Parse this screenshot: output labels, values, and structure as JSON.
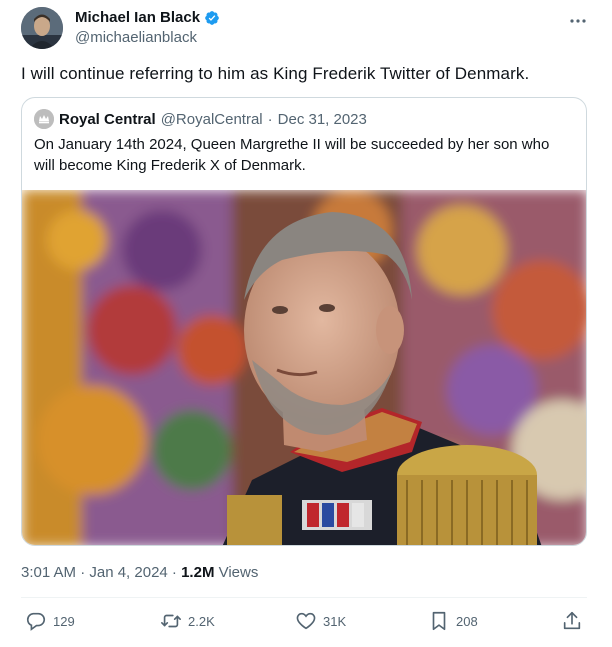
{
  "author": {
    "display_name": "Michael Ian Black",
    "handle": "@michaelianblack"
  },
  "tweet_text": "I will continue referring to him as King Frederik Twitter of Denmark.",
  "quote": {
    "display_name": "Royal Central",
    "handle": "@RoyalCentral",
    "separator": "·",
    "date": "Dec 31, 2023",
    "text": "On January 14th 2024, Queen Margrethe II will be succeeded by her son who will become King Frederik X of Denmark."
  },
  "timestamp": {
    "time_date": "3:01 AM · Jan 4, 2024 · ",
    "views_count": "1.2M",
    "views_label": " Views"
  },
  "actions": {
    "replies": "129",
    "reposts": "2.2K",
    "likes": "31K",
    "bookmarks": "208"
  },
  "colors": {
    "text_primary": "#0f1419",
    "text_secondary": "#536471",
    "verified_blue": "#1d9bf0",
    "border": "#cfd9de"
  }
}
